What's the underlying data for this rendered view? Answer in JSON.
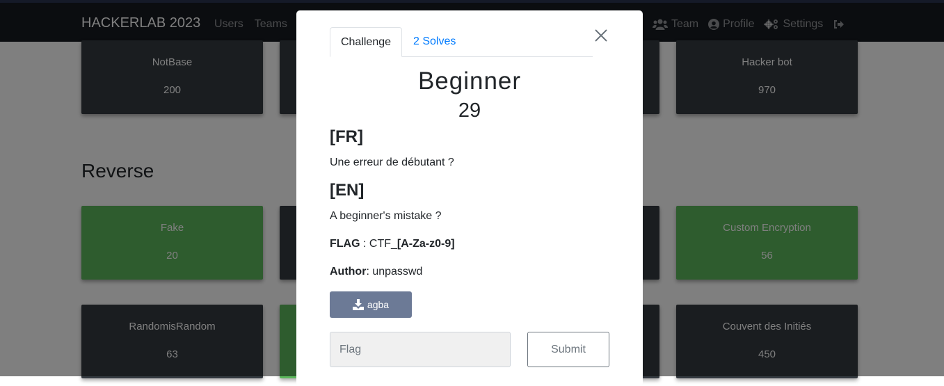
{
  "navbar": {
    "brand": "HACKERLAB 2023",
    "left_links": [
      "Users",
      "Teams"
    ],
    "right_links": [
      {
        "label": "Team",
        "icon": "users-icon"
      },
      {
        "label": "Profile",
        "icon": "user-circle-icon"
      },
      {
        "label": "Settings",
        "icon": "cogs-icon"
      },
      {
        "label": "",
        "icon": "logout-icon"
      }
    ]
  },
  "background": {
    "row1": [
      {
        "name": "NotBase",
        "points": "200"
      },
      {
        "name": "Hacker bot",
        "points": "970"
      }
    ],
    "section_title": "Reverse",
    "row2": [
      {
        "name": "Fake",
        "points": "20"
      },
      {
        "name": "Custom Encryption",
        "points": "56"
      }
    ],
    "row3": [
      {
        "name": "RandomisRandom",
        "points": "63"
      },
      {
        "name": "Couvent des Initiés",
        "points": "450"
      }
    ]
  },
  "modal": {
    "tabs": [
      "Challenge",
      "2 Solves"
    ],
    "challenge_name": "Beginner",
    "challenge_value": "29",
    "description": {
      "fr_heading": "[FR]",
      "fr_text": "Une erreur de débutant ?",
      "en_heading": "[EN]",
      "en_text": "A beginner's mistake ?",
      "flag_label": "FLAG",
      "flag_sep": " : CTF_",
      "flag_format": "[A-Za-z0-9]",
      "author_label": "Author",
      "author_value": ": unpasswd"
    },
    "download_label": "agba",
    "flag_placeholder": "Flag",
    "submit_label": "Submit"
  },
  "colors": {
    "navbar_bg": "#161a20",
    "card_dark": "#343a40",
    "card_solved": "#5cb85c",
    "link": "#007bff",
    "download_button": "#6c7a96"
  }
}
